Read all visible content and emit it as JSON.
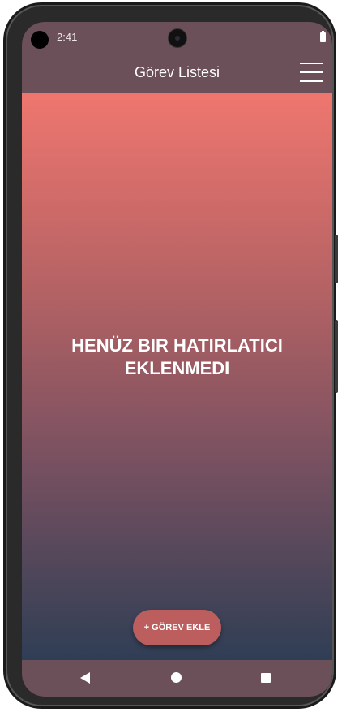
{
  "status_bar": {
    "time": "2:41"
  },
  "app_bar": {
    "title": "Görev Listesi",
    "menu_icon": "hamburger-menu-icon"
  },
  "main": {
    "empty_message_line1": "HENÜZ BIR HATIRLATICI",
    "empty_message_line2": "EKLENMEDI",
    "add_button_label": "+ GÖREV EKLE"
  },
  "colors": {
    "app_bar": "#6b4f59",
    "gradient_top": "#ef766f",
    "gradient_bottom": "#2f3e55",
    "add_button": "#bc5d5e"
  },
  "nav_bar": {
    "icons": [
      "back-icon",
      "home-icon",
      "recents-icon"
    ]
  }
}
